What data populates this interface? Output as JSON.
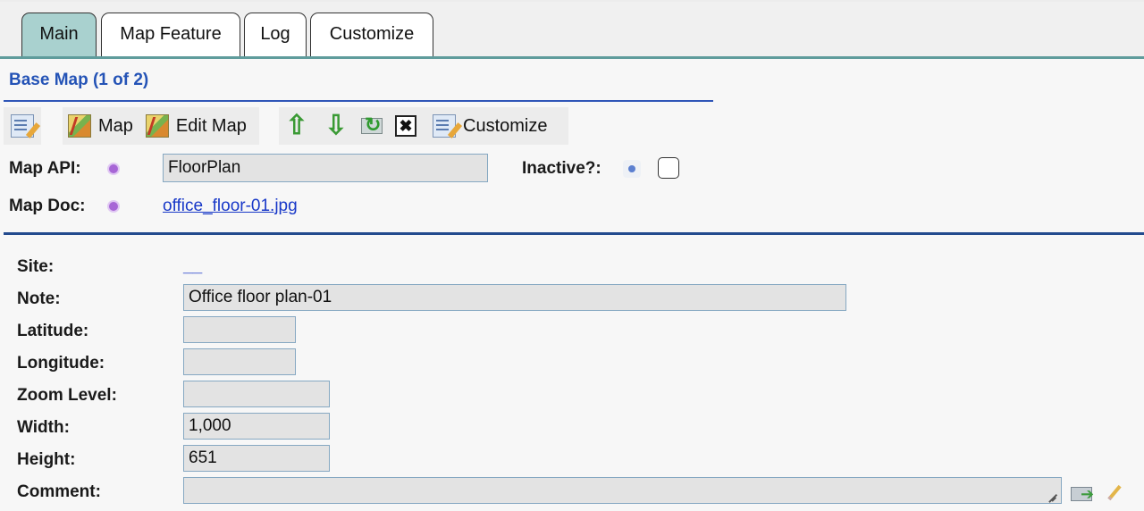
{
  "tabs": [
    {
      "label": "Main",
      "active": true
    },
    {
      "label": "Map Feature",
      "active": false
    },
    {
      "label": "Log",
      "active": false
    },
    {
      "label": "Customize",
      "active": false
    }
  ],
  "section": {
    "title": "Base Map (1 of 2)"
  },
  "toolbar": {
    "map_label": "Map",
    "edit_map_label": "Edit Map",
    "customize_label": "Customize",
    "up_icon": "⇧",
    "down_icon": "⇩",
    "close_icon": "✖"
  },
  "base_fields": {
    "map_api_label": "Map API:",
    "map_api_value": "FloorPlan",
    "inactive_label": "Inactive?:",
    "inactive_checked": false,
    "map_doc_label": "Map Doc:",
    "map_doc_value": "office_floor-01.jpg"
  },
  "details": {
    "site_label": "Site:",
    "site_value": "__",
    "note_label": "Note:",
    "note_value": "Office floor plan-01",
    "latitude_label": "Latitude:",
    "latitude_value": "",
    "longitude_label": "Longitude:",
    "longitude_value": "",
    "zoom_label": "Zoom Level:",
    "zoom_value": "",
    "width_label": "Width:",
    "width_value": "1,000",
    "height_label": "Height:",
    "height_value": "651",
    "comment_label": "Comment:",
    "comment_value": ""
  },
  "colors": {
    "active_tab": "#a9d1cf",
    "tab_line": "#5f9c9c",
    "section_title": "#2453b6",
    "link": "#1838c8",
    "required_dot": "#a766d6"
  }
}
